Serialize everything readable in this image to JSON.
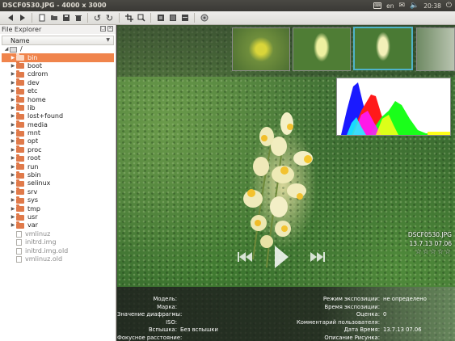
{
  "window": {
    "title": "DSCF0530.JPG  - 4000 x 3000"
  },
  "tray": {
    "keyboard": "en",
    "volume": "◀)",
    "time": "20:38"
  },
  "explorer": {
    "title": "File Explorer",
    "column": "Name",
    "root": "/",
    "items": [
      {
        "label": "bin",
        "type": "folder",
        "selected": true
      },
      {
        "label": "boot",
        "type": "folder"
      },
      {
        "label": "cdrom",
        "type": "folder"
      },
      {
        "label": "dev",
        "type": "folder"
      },
      {
        "label": "etc",
        "type": "folder"
      },
      {
        "label": "home",
        "type": "folder"
      },
      {
        "label": "lib",
        "type": "folder"
      },
      {
        "label": "lost+found",
        "type": "folder"
      },
      {
        "label": "media",
        "type": "folder"
      },
      {
        "label": "mnt",
        "type": "folder"
      },
      {
        "label": "opt",
        "type": "folder"
      },
      {
        "label": "proc",
        "type": "folder"
      },
      {
        "label": "root",
        "type": "folder"
      },
      {
        "label": "run",
        "type": "folder"
      },
      {
        "label": "sbin",
        "type": "folder"
      },
      {
        "label": "selinux",
        "type": "folder"
      },
      {
        "label": "srv",
        "type": "folder"
      },
      {
        "label": "sys",
        "type": "folder"
      },
      {
        "label": "tmp",
        "type": "folder"
      },
      {
        "label": "usr",
        "type": "folder"
      },
      {
        "label": "var",
        "type": "folder"
      },
      {
        "label": "vmlinuz",
        "type": "file"
      },
      {
        "label": "initrd.img",
        "type": "file"
      },
      {
        "label": "initrd.img.old",
        "type": "file"
      },
      {
        "label": "vmlinuz.old",
        "type": "file"
      }
    ]
  },
  "viewer": {
    "filename": "DSCF0530.JPG",
    "datetime": "13.7.13 07.06",
    "stars": "☆☆☆☆☆",
    "rating": 0
  },
  "exif": {
    "left": [
      {
        "k": "Модель:",
        "v": ""
      },
      {
        "k": "Марка:",
        "v": ""
      },
      {
        "k": "Значение диафрагмы:",
        "v": ""
      },
      {
        "k": "ISO:",
        "v": ""
      },
      {
        "k": "Вспышка:",
        "v": "Без вспышки"
      },
      {
        "k": "Фокусное расстояние:",
        "v": ""
      }
    ],
    "right": [
      {
        "k": "Режим экспозиции:",
        "v": "не определено"
      },
      {
        "k": "Время экспозиции:",
        "v": ""
      },
      {
        "k": "Оценка:",
        "v": "0"
      },
      {
        "k": "Комментарий пользователя:",
        "v": ""
      },
      {
        "k": "Дата Время:",
        "v": "13.7.13 07.06"
      },
      {
        "k": "Описание Рисунка:",
        "v": ""
      }
    ]
  },
  "colors": {
    "selection": "#f0844c",
    "folder": "#e07a4a",
    "thumb_selected": "#4fb3c9"
  }
}
